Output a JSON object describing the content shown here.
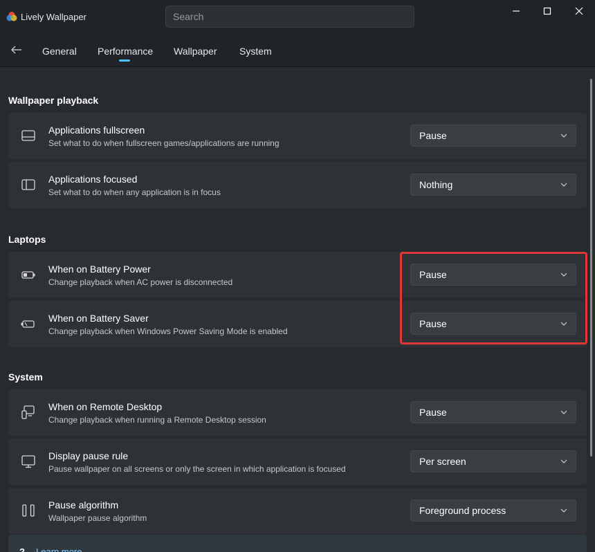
{
  "window": {
    "title": "Lively Wallpaper"
  },
  "search": {
    "placeholder": "Search"
  },
  "nav": {
    "tabs": [
      {
        "label": "General"
      },
      {
        "label": "Performance",
        "active": true
      },
      {
        "label": "Wallpaper"
      },
      {
        "label": "System"
      }
    ]
  },
  "sections": {
    "playback": {
      "title": "Wallpaper playback",
      "items": [
        {
          "title": "Applications fullscreen",
          "desc": "Set what to do when fullscreen games/applications are running",
          "value": "Pause",
          "icon": "fullscreen-icon"
        },
        {
          "title": "Applications focused",
          "desc": "Set what to do when any application is in focus",
          "value": "Nothing",
          "icon": "focused-window-icon"
        }
      ]
    },
    "laptops": {
      "title": "Laptops",
      "items": [
        {
          "title": "When on Battery Power",
          "desc": "Change playback when AC power is disconnected",
          "value": "Pause",
          "icon": "battery-icon"
        },
        {
          "title": "When on Battery Saver",
          "desc": "Change playback when Windows Power Saving Mode is enabled",
          "value": "Pause",
          "icon": "battery-saver-icon"
        }
      ]
    },
    "system": {
      "title": "System",
      "items": [
        {
          "title": "When on Remote Desktop",
          "desc": "Change playback when running a Remote Desktop session",
          "value": "Pause",
          "icon": "remote-desktop-icon"
        },
        {
          "title": "Display pause rule",
          "desc": "Pause wallpaper on all screens or only the screen in which application is focused",
          "value": "Per screen",
          "icon": "monitor-icon"
        },
        {
          "title": "Pause algorithm",
          "desc": "Wallpaper pause algorithm",
          "value": "Foreground process",
          "icon": "pause-icon"
        }
      ]
    }
  },
  "learn_more": {
    "mark": "?",
    "label": "Learn more"
  },
  "colors": {
    "accent": "#4cc2ff",
    "highlight": "#e03838"
  }
}
